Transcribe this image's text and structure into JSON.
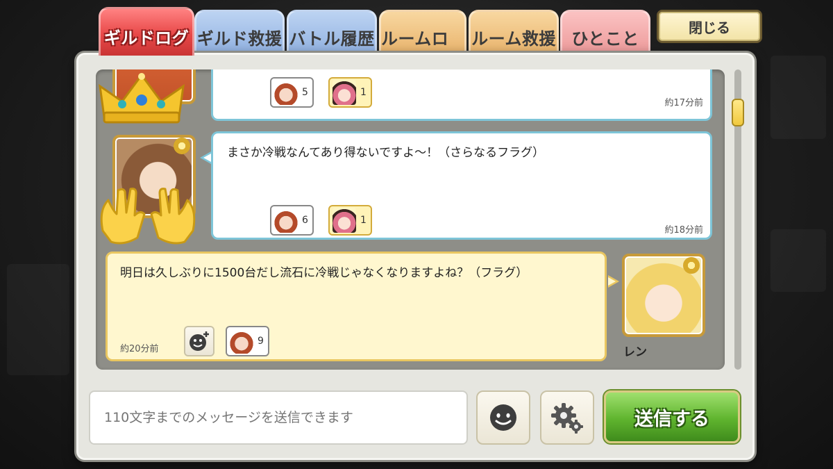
{
  "tabs": [
    {
      "label": "ギルドログ",
      "active": true
    },
    {
      "label": "ギルド救援",
      "active": false
    },
    {
      "label": "バトル履歴",
      "active": false
    },
    {
      "label": "ルームログ",
      "active": false
    },
    {
      "label": "ルーム救援",
      "active": false
    },
    {
      "label": "ひとこと",
      "active": false
    }
  ],
  "close_label": "閉じる",
  "messages": [
    {
      "text": "",
      "time": "約17分前",
      "reactions": [
        {
          "icon": "laughing-face-stamp",
          "count": "5"
        },
        {
          "icon": "pink-hair-character-stamp",
          "count": "1"
        }
      ]
    },
    {
      "text": "まさか冷戦なんてあり得ないですよ～！（さらなるフラグ）",
      "time": "約18分前",
      "reactions": [
        {
          "icon": "laughing-face-stamp",
          "count": "6"
        },
        {
          "icon": "pink-hair-character-stamp",
          "count": "1"
        }
      ]
    },
    {
      "text": "明日は久しぶりに1500台だし流石に冷戦じゃなくなりますよね？（フラグ）",
      "time": "約20分前",
      "author": "レン",
      "reactions": [
        {
          "icon": "laughing-face-stamp",
          "count": "9"
        }
      ]
    }
  ],
  "input": {
    "placeholder": "110文字までのメッセージを送信できます"
  },
  "send_label": "送信する",
  "colors": {
    "active_tab": "#e84848",
    "send_button": "#5fb42e",
    "own_bubble": "#fff7cf",
    "other_bubble_border": "#7ec5d8"
  },
  "icons": [
    "crown-icon",
    "clapping-hands-icon",
    "smiley-add-icon",
    "smiley-icon",
    "gear-icon",
    "guild-medal-icon"
  ]
}
